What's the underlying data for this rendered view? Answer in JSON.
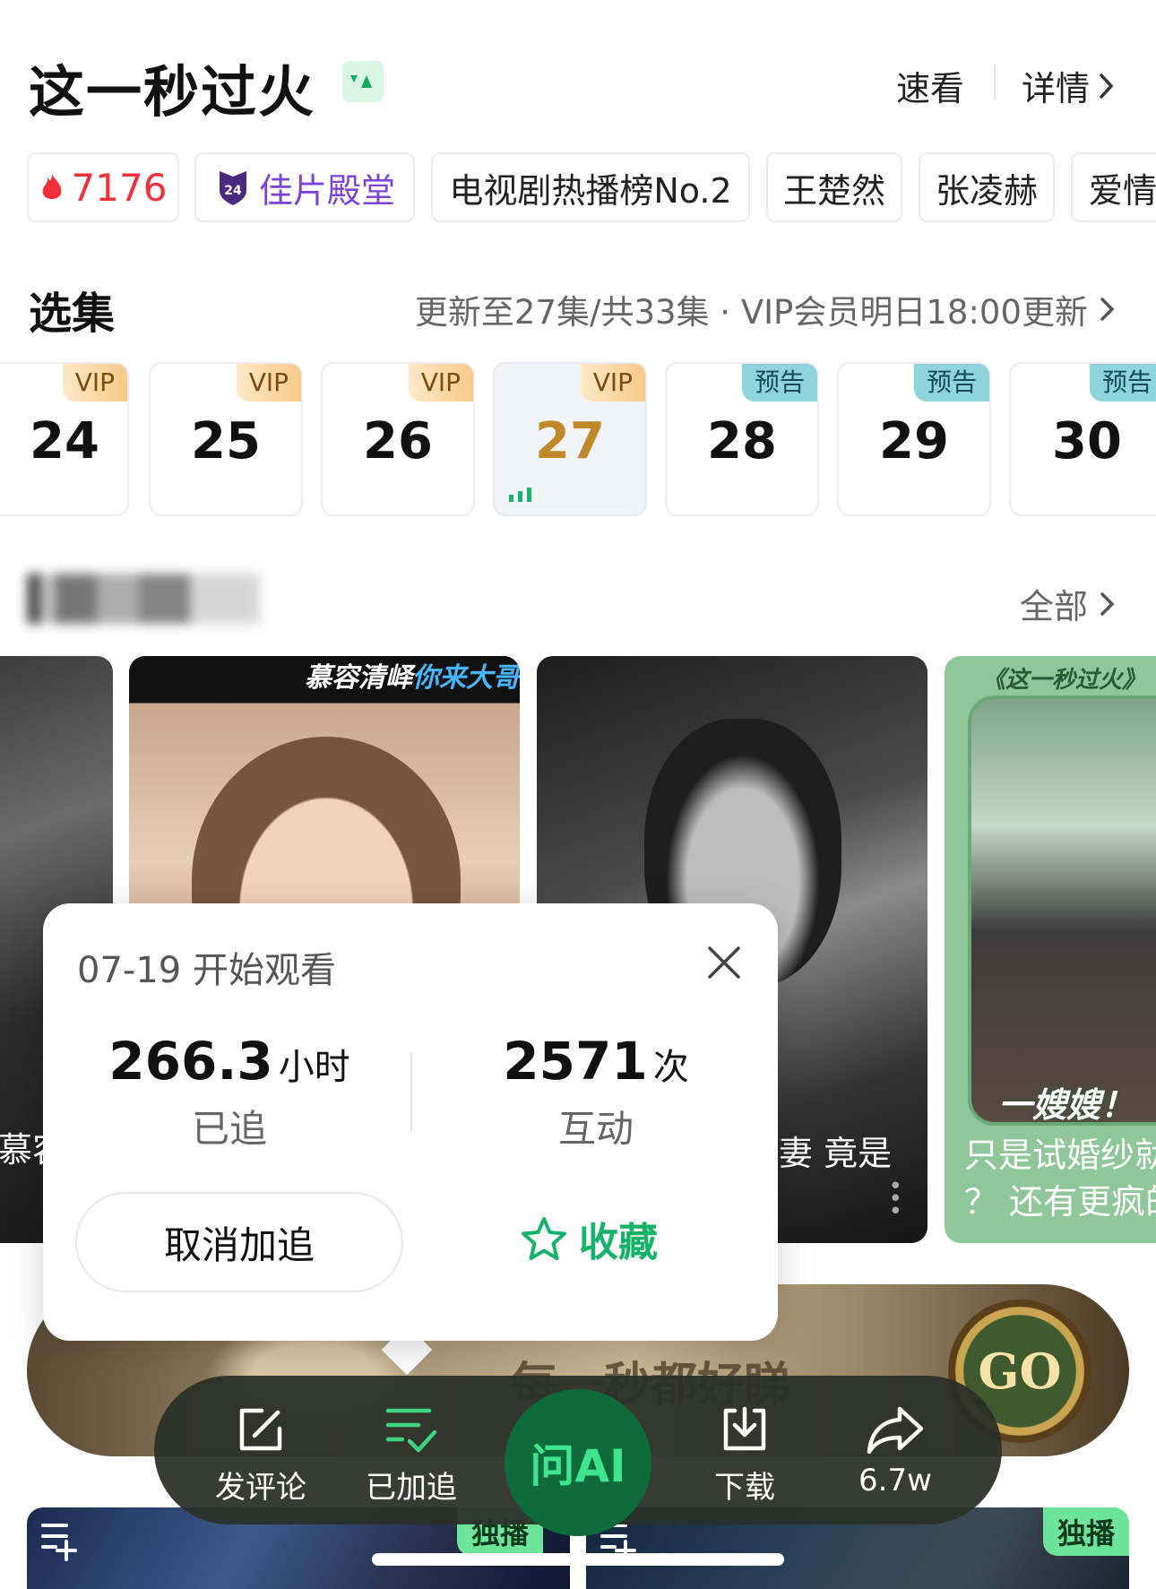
{
  "header": {
    "title": "这一秒过火",
    "badge_icon": "play-badge-icon",
    "quick_view": "速看",
    "details": "详情"
  },
  "tags": [
    {
      "label": "7176",
      "icon": "flame-icon"
    },
    {
      "label": "佳片殿堂",
      "icon": "hall-shield-icon"
    },
    {
      "label": "电视剧热播榜No.2"
    },
    {
      "label": "王楚然"
    },
    {
      "label": "张凌赫"
    },
    {
      "label": "爱情"
    }
  ],
  "episodes_section": {
    "title": "选集",
    "status": "更新至27集/共33集 · VIP会员明日18:00更新",
    "episodes": [
      {
        "num": "24",
        "badge": "VIP"
      },
      {
        "num": "25",
        "badge": "VIP"
      },
      {
        "num": "26",
        "badge": "VIP"
      },
      {
        "num": "27",
        "badge": "VIP",
        "playing": true
      },
      {
        "num": "28",
        "badge": "预告"
      },
      {
        "num": "29",
        "badge": "预告"
      },
      {
        "num": "30",
        "badge": "预告"
      }
    ]
  },
  "clips_section": {
    "all_label": "全部",
    "cards": [
      {
        "caption": "慕容"
      },
      {
        "top_caption_a": "慕容清峄",
        "top_caption_b": "你来大哥"
      },
      {
        "caption": "妻 竟是"
      },
      {
        "top_caption": "《这一秒过火》",
        "overlay": "一嫂嫂！",
        "caption_1": "只是试婚纱就",
        "caption_2": "？ 还有更疯的"
      }
    ]
  },
  "banner": {
    "text": "每一秒都好睇",
    "go": "GO"
  },
  "popup": {
    "date_text": "07-19 开始观看",
    "hours_value": "266.3",
    "hours_unit": "小时",
    "hours_label": "已追",
    "interact_value": "2571",
    "interact_unit": "次",
    "interact_label": "互动",
    "cancel_label": "取消加追",
    "fav_label": "收藏"
  },
  "action_bar": {
    "comment": "发评论",
    "followed": "已加追",
    "ai": "问AI",
    "download": "下载",
    "share": "6.7w"
  },
  "bottom_row": {
    "badge_1": "独播",
    "badge_2": "独播"
  },
  "colors": {
    "accent_green": "#17b26a",
    "hot_red": "#f2303a",
    "hall_purple": "#7a45d6",
    "vip_gold": "#c08a2a"
  }
}
